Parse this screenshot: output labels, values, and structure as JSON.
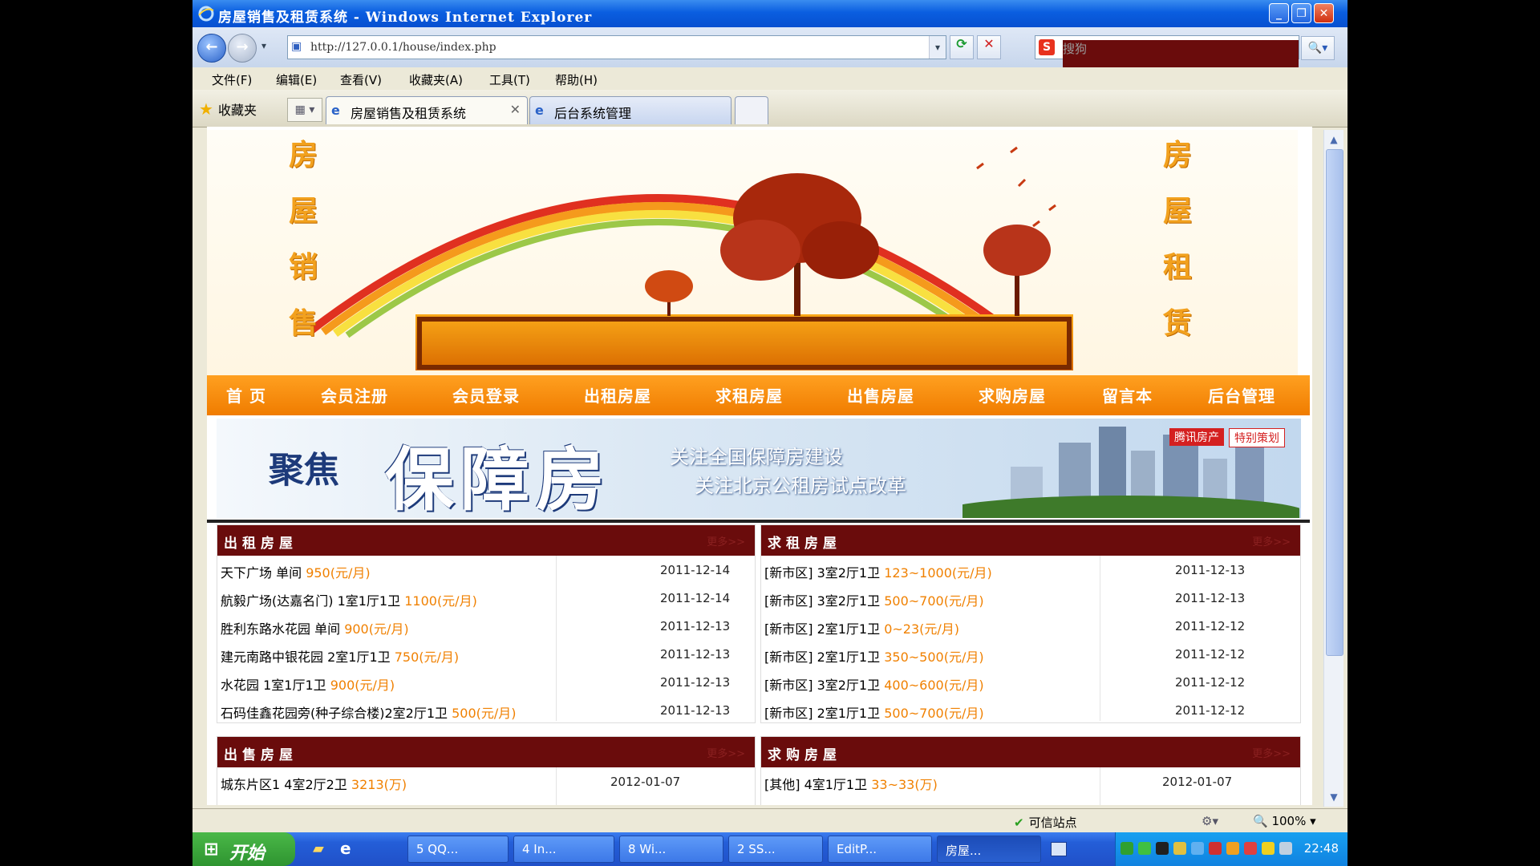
{
  "window": {
    "title": "房屋销售及租赁系统 - Windows Internet Explorer",
    "min": "_",
    "max": "❐",
    "close": "✕"
  },
  "browser": {
    "url": "http://127.0.0.1/house/index.php",
    "search_placeholder": "搜狗",
    "back": "←",
    "forward": "→",
    "dropdown": "▾",
    "refresh": "⟳",
    "stop": "✕",
    "go": "🔍▾"
  },
  "menu": [
    "文件(F)",
    "编辑(E)",
    "查看(V)",
    "收藏夹(A)",
    "工具(T)",
    "帮助(H)"
  ],
  "favorites_label": "收藏夹",
  "tabs": [
    {
      "label": "房屋销售及租赁系统",
      "close": "✕"
    },
    {
      "label": "后台系统管理"
    }
  ],
  "banner": {
    "left_chars": [
      "房",
      "屋",
      "销",
      "售"
    ],
    "right_chars": [
      "房",
      "屋",
      "租",
      "赁"
    ]
  },
  "nav": [
    "首 页",
    "会员注册",
    "会员登录",
    "出租房屋",
    "求租房屋",
    "出售房屋",
    "求购房屋",
    "留言本",
    "后台管理"
  ],
  "ad": {
    "focus": "聚焦",
    "headline": "保障房",
    "line1": "关注全国保障房建设",
    "line2": "关注北京公租房试点改革",
    "tag1": "腾讯房产",
    "tag2": "特别策划"
  },
  "panels": {
    "rent_out": {
      "title": "出租房屋",
      "more": "更多>>",
      "rows": [
        {
          "name": "天下广场 单间",
          "price": "950(元/月)",
          "date": "2011-12-14"
        },
        {
          "name": "航毅广场(达嘉名门) 1室1厅1卫",
          "price": "1100(元/月)",
          "date": "2011-12-14"
        },
        {
          "name": "胜利东路水花园 单间",
          "price": "900(元/月)",
          "date": "2011-12-13"
        },
        {
          "name": "建元南路中银花园 2室1厅1卫",
          "price": "750(元/月)",
          "date": "2011-12-13"
        },
        {
          "name": "水花园 1室1厅1卫",
          "price": "900(元/月)",
          "date": "2011-12-13"
        },
        {
          "name": "石码佳鑫花园旁(种子综合楼)2室2厅1卫",
          "price": "500(元/月)",
          "date": "2011-12-13"
        }
      ]
    },
    "rent_want": {
      "title": "求租房屋",
      "more": "更多>>",
      "rows": [
        {
          "name": "[新市区] 3室2厅1卫",
          "price": "123~1000(元/月)",
          "date": "2011-12-13"
        },
        {
          "name": "[新市区] 3室2厅1卫",
          "price": "500~700(元/月)",
          "date": "2011-12-13"
        },
        {
          "name": "[新市区] 2室1厅1卫",
          "price": "0~23(元/月)",
          "date": "2011-12-12"
        },
        {
          "name": "[新市区] 2室1厅1卫",
          "price": "350~500(元/月)",
          "date": "2011-12-12"
        },
        {
          "name": "[新市区] 3室2厅1卫",
          "price": "400~600(元/月)",
          "date": "2011-12-12"
        },
        {
          "name": "[新市区] 2室1厅1卫",
          "price": "500~700(元/月)",
          "date": "2011-12-12"
        }
      ]
    },
    "sale": {
      "title": "出售房屋",
      "more": "更多>>",
      "rows": [
        {
          "name": "城东片区1 4室2厅2卫",
          "price": "3213(万)",
          "date": "2012-01-07"
        }
      ]
    },
    "buy": {
      "title": "求购房屋",
      "more": "更多>>",
      "rows": [
        {
          "name": "[其他] 4室1厅1卫",
          "price": "33~33(万)",
          "date": "2012-01-07"
        }
      ]
    }
  },
  "status": {
    "trusted": "可信站点",
    "zoom": "100%"
  },
  "taskbar": {
    "start": "开始",
    "tasks": [
      "5 QQ...",
      "4 In...",
      "8 Wi...",
      "2 SS...",
      "EditP...",
      "房屋..."
    ],
    "clock": "22:48"
  },
  "colors": {
    "nav_orange": "#f58a0a",
    "panel_header": "#6a0c0c",
    "price_orange": "#f08000"
  }
}
